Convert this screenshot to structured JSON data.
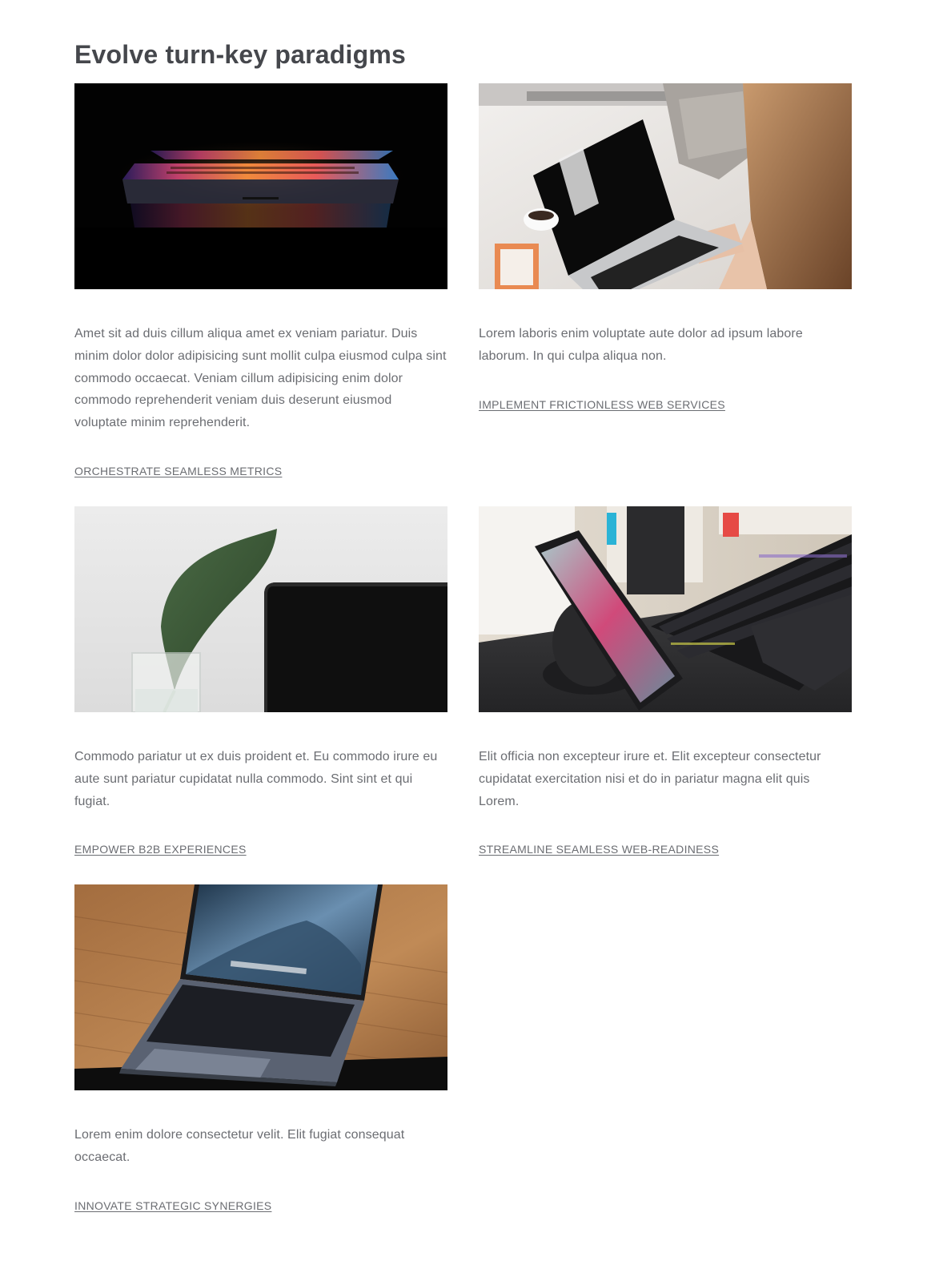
{
  "section": {
    "title": "Evolve turn-key paradigms"
  },
  "cards": [
    {
      "image": "laptop-glowing-keyboard-image",
      "description": "Amet sit ad duis cillum aliqua amet ex veniam pariatur. Duis minim dolor dolor adipisicing sunt mollit culpa eiusmod culpa sint commodo occaecat. Veniam cillum adipisicing enim dolor commodo reprehenderit veniam duis deserunt eiusmod voluptate minim reprehenderit.",
      "link": "ORCHESTRATE SEAMLESS METRICS"
    },
    {
      "image": "woman-typing-laptop-image",
      "description": "Lorem laboris enim voluptate aute dolor ad ipsum labore laborum. In qui culpa aliqua non.",
      "link": "IMPLEMENT FRICTIONLESS WEB SERVICES"
    },
    {
      "image": "leaf-vase-laptop-image",
      "description": "Commodo pariatur ut ex duis proident et. Eu commodo irure eu aute sunt pariatur cupidatat nulla commodo. Sint sint et qui fugiat.",
      "link": "EMPOWER B2B EXPERIENCES"
    },
    {
      "image": "phone-charger-keyboard-image",
      "description": "Elit officia non excepteur irure et. Elit excepteur consectetur cupidatat exercitation nisi et do in pariatur magna elit quis Lorem.",
      "link": "STREAMLINE SEAMLESS WEB-READINESS"
    },
    {
      "image": "laptop-wooden-desk-image",
      "description": "Lorem enim dolore consectetur velit. Elit fugiat consequat occaecat.",
      "link": "INNOVATE STRATEGIC SYNERGIES"
    }
  ]
}
